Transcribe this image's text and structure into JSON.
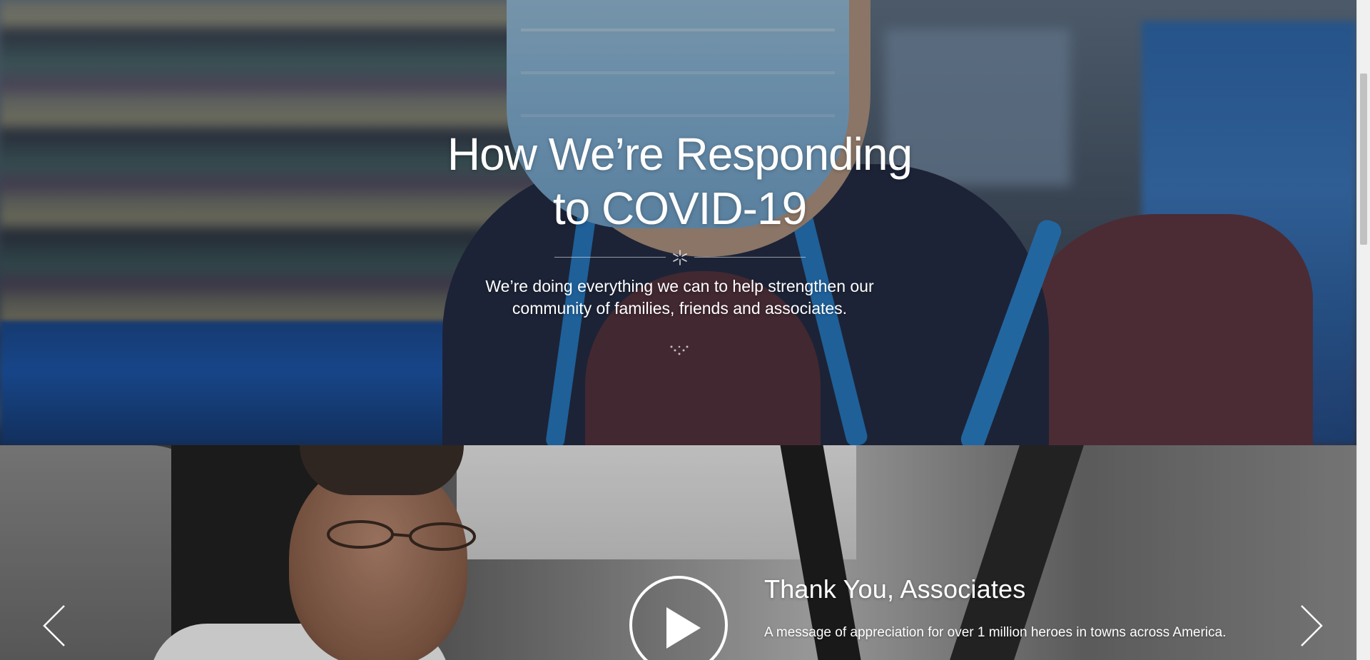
{
  "hero": {
    "title_line1": "How We’re Responding",
    "title_line2": "to COVID-19",
    "subtitle_line1": "We’re doing everything we can to help strengthen our",
    "subtitle_line2": "community of families, friends and associates.",
    "icons": {
      "divider": "spark-icon",
      "scroll": "chevron-down-icon"
    }
  },
  "video_carousel": {
    "slide_title": "Thank You, Associates",
    "slide_description": "A message of appreciation for over 1 million heroes in towns across America.",
    "icons": {
      "play": "play-icon",
      "prev": "chevron-left-icon",
      "next": "chevron-right-icon"
    }
  },
  "colors": {
    "text": "#ffffff",
    "vest": "#262d45",
    "strap_blue": "#2a86d4",
    "mask_blue": "#8ec2e8",
    "shirt_maroon": "#5e343b"
  }
}
